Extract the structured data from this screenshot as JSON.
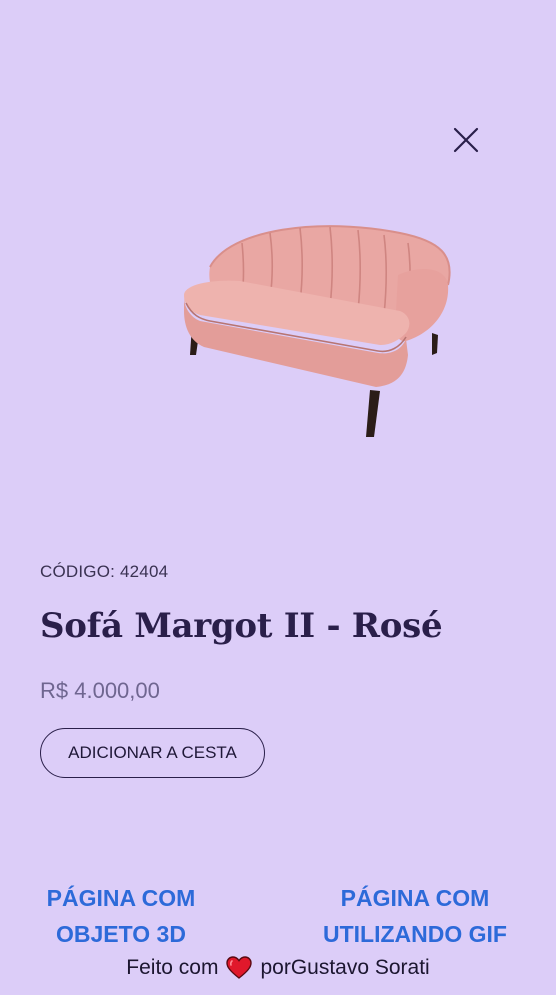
{
  "modal": {
    "close_icon": "close-icon"
  },
  "product": {
    "image_icon": "sofa-image",
    "code_label": "CÓDIGO: 42404",
    "name": "Sofá Margot II - Rosé",
    "price": "R$ 4.000,00",
    "add_to_cart_label": "ADICIONAR A CESTA"
  },
  "links": {
    "page_3d_line1": "PÁGINA COM",
    "page_3d_line2": "OBJETO 3D",
    "page_gif_line1": "PÁGINA COM",
    "page_gif_line2": "UTILIZANDO GIF"
  },
  "footer": {
    "made_with": "Feito com",
    "heart_icon": "heart-icon",
    "by_author": "porGustavo Sorati"
  },
  "colors": {
    "background": "#dccdf8",
    "text_dark": "#2a1f4a",
    "price": "#6f6690",
    "link": "#2d6ad9",
    "sofa": "#e9a7a3",
    "heart": "#e0182b"
  }
}
